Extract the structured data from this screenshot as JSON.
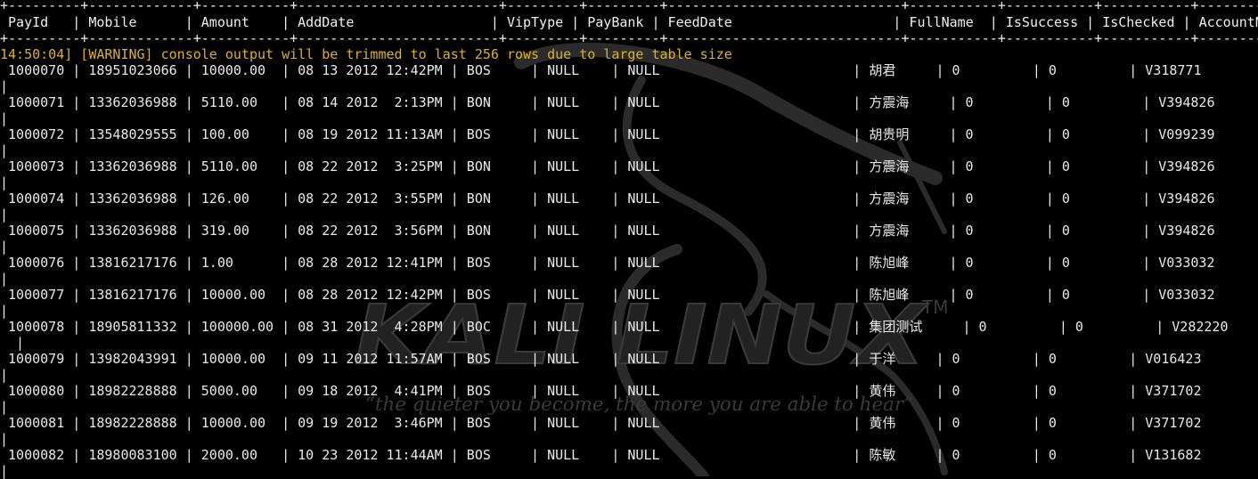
{
  "wallpaper": {
    "logo_text": "KALI LINUX",
    "trademark": "TM",
    "tagline": "“the quieter you become, the more you are able to hear”",
    "dragon_icon": "kali-dragon-icon"
  },
  "terminal": {
    "border_line": "+---------+-------------+-----------+-------------------------+---------+---------+-----------------------------+-----------+-----------+-----------+-------------+",
    "header_line": " PayId   | Mobile      | Amount    | AddDate                 | VipType | PayBank | FeedDate                    | FullName  | IsSuccess | IsChecked | AccountName |",
    "warning_line": "14:50:04] [WARNING] console output will be trimmed to last 256 rows due to large table size",
    "rows": [
      " 1000070 | 18951023066 | 10000.00  | 08 13 2012 12:42PM | BOS     | NULL    | NULL                        | 胡君     | 0         | 0         | V318771",
      " 1000071 | 13362036988 | 5110.00   | 08 14 2012  2:13PM | BON     | NULL    | NULL                        | 方震海     | 0         | 0         | V394826",
      " 1000072 | 13548029555 | 100.00    | 08 19 2012 11:13AM | BOS     | NULL    | NULL                        | 胡贵明     | 0         | 0         | V099239",
      " 1000073 | 13362036988 | 5110.00   | 08 22 2012  3:25PM | BON     | NULL    | NULL                        | 方震海     | 0         | 0         | V394826",
      " 1000074 | 13362036988 | 126.00    | 08 22 2012  3:55PM | BON     | NULL    | NULL                        | 方震海     | 0         | 0         | V394826",
      " 1000075 | 13362036988 | 319.00    | 08 22 2012  3:56PM | BON     | NULL    | NULL                        | 方震海     | 0         | 0         | V394826",
      " 1000076 | 13816217176 | 1.00      | 08 28 2012 12:41PM | BOS     | NULL    | NULL                        | 陈旭峰     | 0         | 0         | V033032",
      " 1000077 | 13816217176 | 10000.00  | 08 28 2012 12:42PM | BOS     | NULL    | NULL                        | 陈旭峰     | 0         | 0         | V033032",
      " 1000078 | 18905811332 | 100000.00 | 08 31 2012  4:28PM | BOC     | NULL    | NULL                        | 集团测试     | 0         | 0         | V282220",
      " 1000079 | 13982043991 | 10000.00  | 09 11 2012 11:57AM | BOS     | NULL    | NULL                        | 于洋     | 0         | 0         | V016423",
      " 1000080 | 18982228888 | 5000.00   | 09 18 2012  4:41PM | BOS     | NULL    | NULL                        | 黄伟     | 0         | 0         | V371702",
      " 1000081 | 18982228888 | 10000.00  | 09 19 2012  3:46PM | BOS     | NULL    | NULL                        | 黄伟     | 0         | 0         | V371702",
      " 1000082 | 18980083100 | 2000.00   | 10 23 2012 11:44AM | BOS     | NULL    | NULL                        | 陈敏     | 0         | 0         | V131682"
    ],
    "continuation_lines": [
      "|",
      "|",
      "|",
      "|",
      "|",
      "|",
      "|",
      "|",
      "  |",
      "|",
      "|",
      "|",
      "|"
    ]
  }
}
